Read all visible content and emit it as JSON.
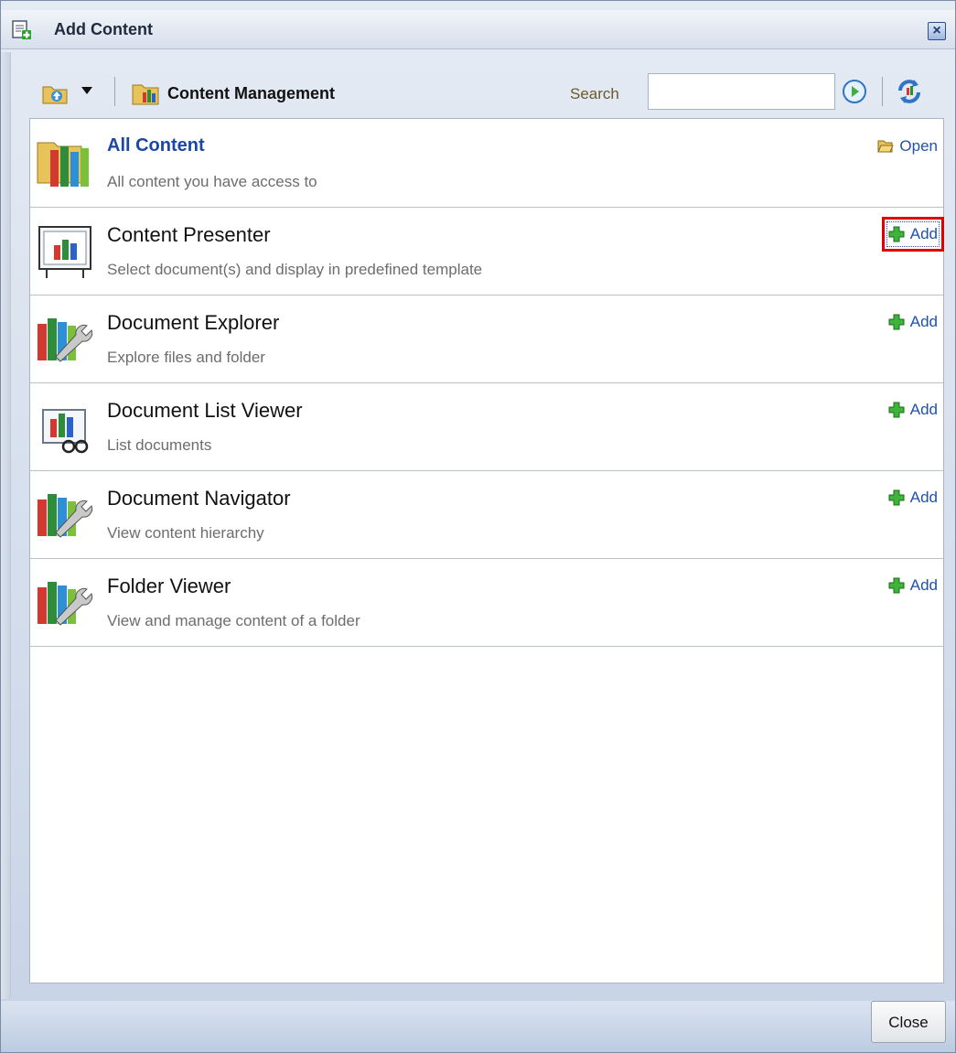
{
  "dialog": {
    "title": "Add Content",
    "close_icon": "close-x-icon"
  },
  "toolbar": {
    "up_icon": "folder-up-icon",
    "menu_icon": "dropdown-arrow-icon",
    "folder_icon": "content-folder-icon",
    "path_label": "Content Management",
    "search_label": "Search",
    "search_value": "",
    "search_go_icon": "go-arrow-icon",
    "refresh_icon": "refresh-icon"
  },
  "items": [
    {
      "title": "All Content",
      "description": "All content you have access to",
      "action": "Open",
      "action_icon": "open-folder-icon",
      "icon": "books-folder-icon"
    },
    {
      "title": "Content Presenter",
      "description": "Select document(s) and display in predefined template",
      "action": "Add",
      "action_icon": "add-plus-icon",
      "icon": "presentation-board-icon"
    },
    {
      "title": "Document Explorer",
      "description": "Explore files and folder",
      "action": "Add",
      "action_icon": "add-plus-icon",
      "icon": "books-wrench-icon"
    },
    {
      "title": "Document List Viewer",
      "description": "List documents",
      "action": "Add",
      "action_icon": "add-plus-icon",
      "icon": "books-glasses-icon"
    },
    {
      "title": "Document Navigator",
      "description": "View content hierarchy",
      "action": "Add",
      "action_icon": "add-plus-icon",
      "icon": "books-wrench-icon"
    },
    {
      "title": "Folder Viewer",
      "description": "View and manage content of a folder",
      "action": "Add",
      "action_icon": "add-plus-icon",
      "icon": "books-wrench-icon"
    }
  ],
  "footer": {
    "close_label": "Close"
  },
  "colors": {
    "link": "#2152a8",
    "highlight": "#e00000",
    "add_green": "#2aa32a"
  }
}
